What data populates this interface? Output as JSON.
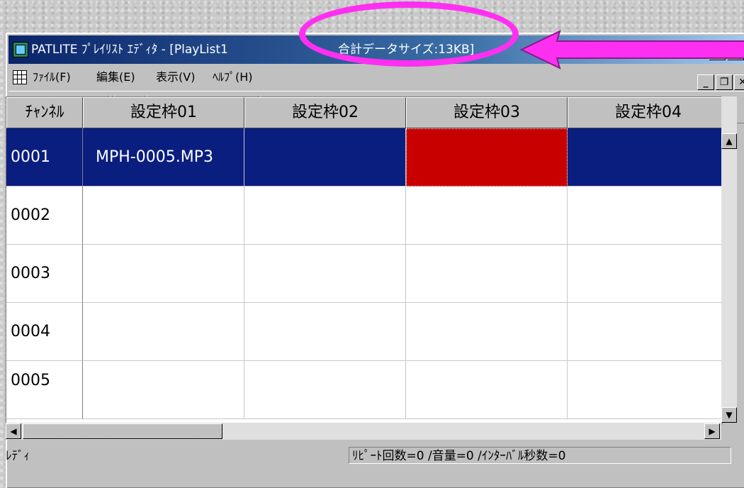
{
  "window": {
    "title": "PATLITE ﾌﾟﾚｲﾘｽﾄ ｴﾃﾞｨﾀ - [PlayList1",
    "title_size": "合計データサイズ:13KB]"
  },
  "menu": [
    {
      "label": "ﾌｧｲﾙ(F)"
    },
    {
      "label": "編集(E)"
    },
    {
      "label": "表示(V)"
    },
    {
      "label": "ﾍﾙﾌﾟ(H)"
    }
  ],
  "toolbar": {
    "icons": [
      "new-file-icon",
      "open-folder-icon",
      "save-icon",
      "csv-icon",
      "playlist-icon",
      "cut-icon",
      "copy-icon",
      "paste-icon",
      "clear-icon",
      "window-icon",
      "play-icon"
    ]
  },
  "grid": {
    "headers": [
      "ﾁｬﾝﾈﾙ",
      "設定枠01",
      "設定枠02",
      "設定枠03",
      "設定枠04"
    ],
    "rows": [
      {
        "channel": "0001",
        "c1": "MPH-0005.MP3",
        "c2": "",
        "c3": "",
        "c4": ""
      },
      {
        "channel": "0002",
        "c1": "",
        "c2": "",
        "c3": "",
        "c4": ""
      },
      {
        "channel": "0003",
        "c1": "",
        "c2": "",
        "c3": "",
        "c4": ""
      },
      {
        "channel": "0004",
        "c1": "",
        "c2": "",
        "c3": "",
        "c4": ""
      },
      {
        "channel": "0005",
        "c1": "",
        "c2": "",
        "c3": "",
        "c4": ""
      }
    ]
  },
  "status": {
    "left": "ﾚﾃﾞｨ",
    "right": "ﾘﾋﾟｰﾄ回数=0 /音量=0 /ｲﾝﾀｰﾊﾞﾙ秒数=0"
  },
  "colors": {
    "annotation": "#ff2ff2",
    "selection": "#0a1e80",
    "highlight": "#c80000"
  }
}
